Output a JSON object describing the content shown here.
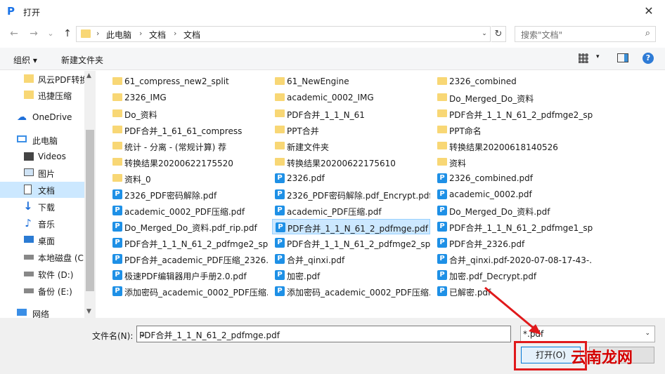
{
  "window": {
    "title": "打开",
    "close": "✕"
  },
  "nav": {
    "back": "←",
    "forward": "→",
    "down": "⌄",
    "up": "↑",
    "crumbs": [
      "此电脑",
      "文档",
      "文档"
    ],
    "refresh": "↻"
  },
  "search": {
    "placeholder": "搜索\"文档\"",
    "icon": "⌕"
  },
  "toolbar": {
    "organize": "组织 ▾",
    "new_folder": "新建文件夹",
    "view_drop": "▾",
    "help": "?"
  },
  "sidebar": {
    "items": [
      {
        "label": "风云PDF转换",
        "icon": "folder"
      },
      {
        "label": "迅捷压缩",
        "icon": "folder"
      },
      {
        "label": "OneDrive",
        "icon": "cloud"
      },
      {
        "label": "此电脑",
        "icon": "computer"
      },
      {
        "label": "Videos",
        "icon": "video"
      },
      {
        "label": "图片",
        "icon": "picture"
      },
      {
        "label": "文档",
        "icon": "document"
      },
      {
        "label": "下载",
        "icon": "download"
      },
      {
        "label": "音乐",
        "icon": "music"
      },
      {
        "label": "桌面",
        "icon": "desktop"
      },
      {
        "label": "本地磁盘 (C:",
        "icon": "drive"
      },
      {
        "label": "软件 (D:)",
        "icon": "drive"
      },
      {
        "label": "备份 (E:)",
        "icon": "drive"
      },
      {
        "label": "网络",
        "icon": "network"
      }
    ]
  },
  "scroll": {
    "up": "▲",
    "down": "▼"
  },
  "files": {
    "col1": [
      {
        "name": "61_compress_new2_split",
        "type": "folder"
      },
      {
        "name": "2326_IMG",
        "type": "folder"
      },
      {
        "name": "Do_资料",
        "type": "folder"
      },
      {
        "name": "PDF合并_1_61_61_compress",
        "type": "folder"
      },
      {
        "name": "统计 - 分离 - (常规计算) 荐",
        "type": "folder"
      },
      {
        "name": "转换结果20200622175520",
        "type": "folder"
      },
      {
        "name": "资料_0",
        "type": "folder"
      },
      {
        "name": "2326_PDF密码解除.pdf",
        "type": "pdf"
      },
      {
        "name": "academic_0002_PDF压缩.pdf",
        "type": "pdf"
      },
      {
        "name": "Do_Merged_Do_资料.pdf_rip.pdf",
        "type": "pdf"
      },
      {
        "name": "PDF合并_1_1_N_61_2_pdfmge2_sp...",
        "type": "pdf"
      },
      {
        "name": "PDF合并_academic_PDF压缩_2326....",
        "type": "pdf"
      },
      {
        "name": "极速PDF编辑器用户手册2.0.pdf",
        "type": "pdf"
      },
      {
        "name": "添加密码_academic_0002_PDF压缩...",
        "type": "pdf"
      }
    ],
    "col2": [
      {
        "name": "61_NewEngine",
        "type": "folder"
      },
      {
        "name": "academic_0002_IMG",
        "type": "folder"
      },
      {
        "name": "PDF合并_1_1_N_61",
        "type": "folder"
      },
      {
        "name": "PPT合并",
        "type": "folder"
      },
      {
        "name": "新建文件夹",
        "type": "folder"
      },
      {
        "name": "转换结果20200622175610",
        "type": "folder"
      },
      {
        "name": "2326.pdf",
        "type": "pdf"
      },
      {
        "name": "2326_PDF密码解除.pdf_Encrypt.pdf",
        "type": "pdf"
      },
      {
        "name": "academic_PDF压缩.pdf",
        "type": "pdf"
      },
      {
        "name": "PDF合并_1_1_N_61_2_pdfmge.pdf",
        "type": "pdf"
      },
      {
        "name": "PDF合并_1_1_N_61_2_pdfmge2_sp...",
        "type": "pdf"
      },
      {
        "name": "合并_qinxi.pdf",
        "type": "pdf"
      },
      {
        "name": "加密.pdf",
        "type": "pdf"
      },
      {
        "name": "添加密码_academic_0002_PDF压缩...",
        "type": "pdf"
      }
    ],
    "col3": [
      {
        "name": "2326_combined",
        "type": "folder"
      },
      {
        "name": "Do_Merged_Do_资料",
        "type": "folder"
      },
      {
        "name": "PDF合并_1_1_N_61_2_pdfmge2_sp...",
        "type": "folder"
      },
      {
        "name": "PPT命名",
        "type": "folder"
      },
      {
        "name": "转换结果20200618140526",
        "type": "folder"
      },
      {
        "name": "资料",
        "type": "folder"
      },
      {
        "name": "2326_combined.pdf",
        "type": "pdf"
      },
      {
        "name": "academic_0002.pdf",
        "type": "pdf"
      },
      {
        "name": "Do_Merged_Do_资料.pdf",
        "type": "pdf"
      },
      {
        "name": "PDF合并_1_1_N_61_2_pdfmge1_sp...",
        "type": "pdf"
      },
      {
        "name": "PDF合并_2326.pdf",
        "type": "pdf"
      },
      {
        "name": "合并_qinxi.pdf-2020-07-08-17-43-...",
        "type": "pdf"
      },
      {
        "name": "加密.pdf_Decrypt.pdf",
        "type": "pdf"
      },
      {
        "name": "已解密.pdf",
        "type": "pdf"
      }
    ]
  },
  "bottom": {
    "filename_label": "文件名(N):",
    "filename_value": "PDF合并_1_1_N_61_2_pdfmge.pdf",
    "filter_value": "*.pdf",
    "open_label": "打开(O)",
    "drop": "⌄"
  },
  "watermark": "云南龙网",
  "colors": {
    "accent": "#0078d7",
    "folder": "#f8d775",
    "pdf": "#1e90e6",
    "highlight": "#e0191b"
  }
}
